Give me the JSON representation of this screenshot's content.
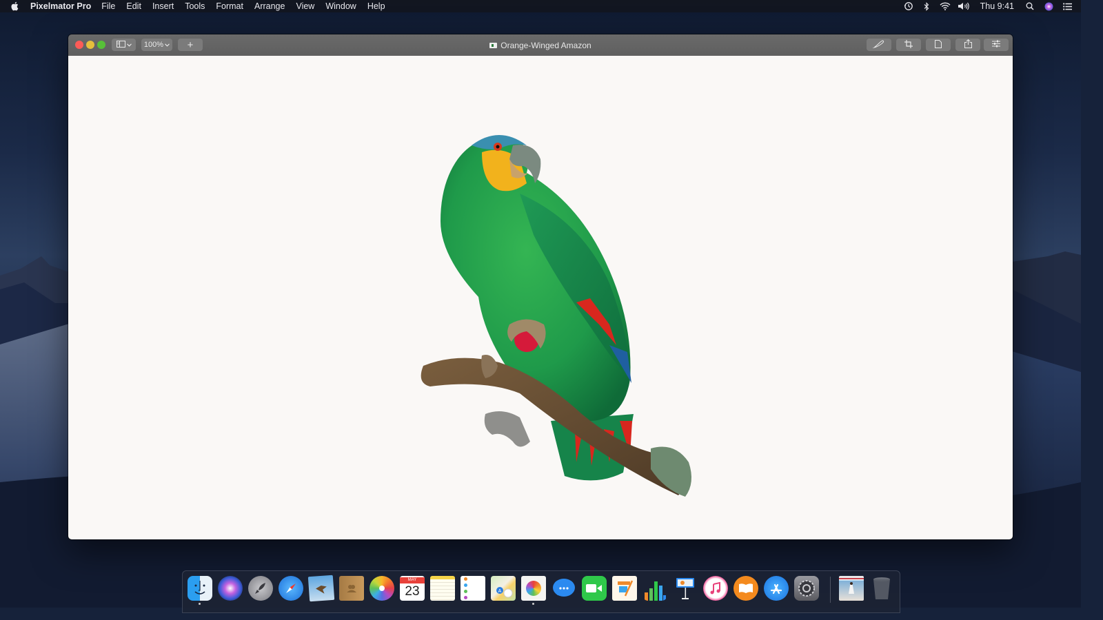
{
  "menubar": {
    "app_name": "Pixelmator Pro",
    "menus": [
      "File",
      "Edit",
      "Insert",
      "Tools",
      "Format",
      "Arrange",
      "View",
      "Window",
      "Help"
    ],
    "clock": "Thu 9:41",
    "status_icons": [
      "time-machine-icon",
      "bluetooth-icon",
      "wifi-icon",
      "volume-icon",
      "spotlight-icon",
      "siri-icon",
      "notification-center-icon"
    ]
  },
  "window": {
    "title": "Orange-Winged Amazon",
    "zoom_level": "100%",
    "add_button": "+",
    "toolbar_right": [
      "repair-brush-icon",
      "crop-icon",
      "document-icon",
      "share-icon",
      "adjustments-icon"
    ]
  },
  "canvas": {
    "subject": "Orange-Winged Amazon parrot illustration",
    "colors": {
      "background": "#faf8f6",
      "feather_green": "#1f9a4a",
      "face_yellow": "#f2b21c",
      "crown_blue": "#3a8fb0",
      "wing_red": "#d8271e",
      "branch_brown": "#6b5034",
      "berry_red": "#d51a3a"
    }
  },
  "dock": {
    "apps": [
      {
        "name": "Finder",
        "running": true
      },
      {
        "name": "Siri",
        "running": false
      },
      {
        "name": "Launchpad",
        "running": false
      },
      {
        "name": "Safari",
        "running": false
      },
      {
        "name": "Mail",
        "running": false
      },
      {
        "name": "Contacts",
        "running": false
      },
      {
        "name": "Photos",
        "running": false
      },
      {
        "name": "Calendar",
        "running": false,
        "month": "MAY",
        "day": "23"
      },
      {
        "name": "Notes",
        "running": false
      },
      {
        "name": "Reminders",
        "running": false
      },
      {
        "name": "Maps",
        "running": false
      },
      {
        "name": "Pixelmator Pro",
        "running": true
      },
      {
        "name": "Messages",
        "running": false
      },
      {
        "name": "FaceTime",
        "running": false
      },
      {
        "name": "Pages",
        "running": false
      },
      {
        "name": "Numbers",
        "running": false
      },
      {
        "name": "Keynote",
        "running": false
      },
      {
        "name": "iTunes",
        "running": false
      },
      {
        "name": "iBooks",
        "running": false
      },
      {
        "name": "App Store",
        "running": false
      },
      {
        "name": "System Preferences",
        "running": false
      },
      {
        "name": "Downloads Stack",
        "running": false
      },
      {
        "name": "Trash",
        "running": false
      }
    ]
  }
}
